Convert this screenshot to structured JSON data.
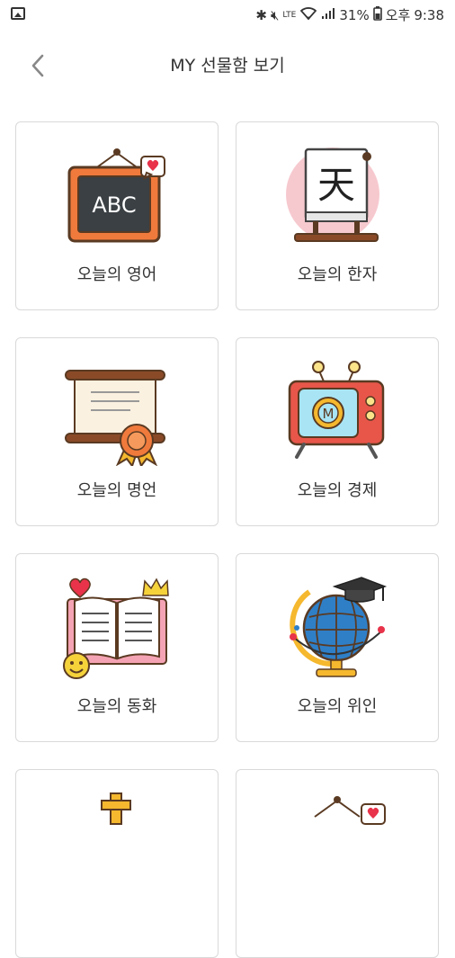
{
  "status": {
    "battery_percent": "31%",
    "ampm": "오후",
    "time": "9:38",
    "lte": "LTE"
  },
  "header": {
    "title": "MY 선물함 보기"
  },
  "cards": [
    {
      "label": "오늘의 영어",
      "icon": "chalkboard-abc-icon"
    },
    {
      "label": "오늘의 한자",
      "icon": "hanja-scroll-icon"
    },
    {
      "label": "오늘의 명언",
      "icon": "certificate-scroll-icon"
    },
    {
      "label": "오늘의 경제",
      "icon": "retro-tv-icon"
    },
    {
      "label": "오늘의 동화",
      "icon": "storybook-icon"
    },
    {
      "label": "오늘의 위인",
      "icon": "globe-graduation-icon"
    }
  ],
  "chalkboard_text": "ABC",
  "hanja_char": "天",
  "tv_char": "M",
  "colors": {
    "card_border": "#d9d9d9",
    "orange": "#f07a3c",
    "heart": "#e8334a"
  }
}
